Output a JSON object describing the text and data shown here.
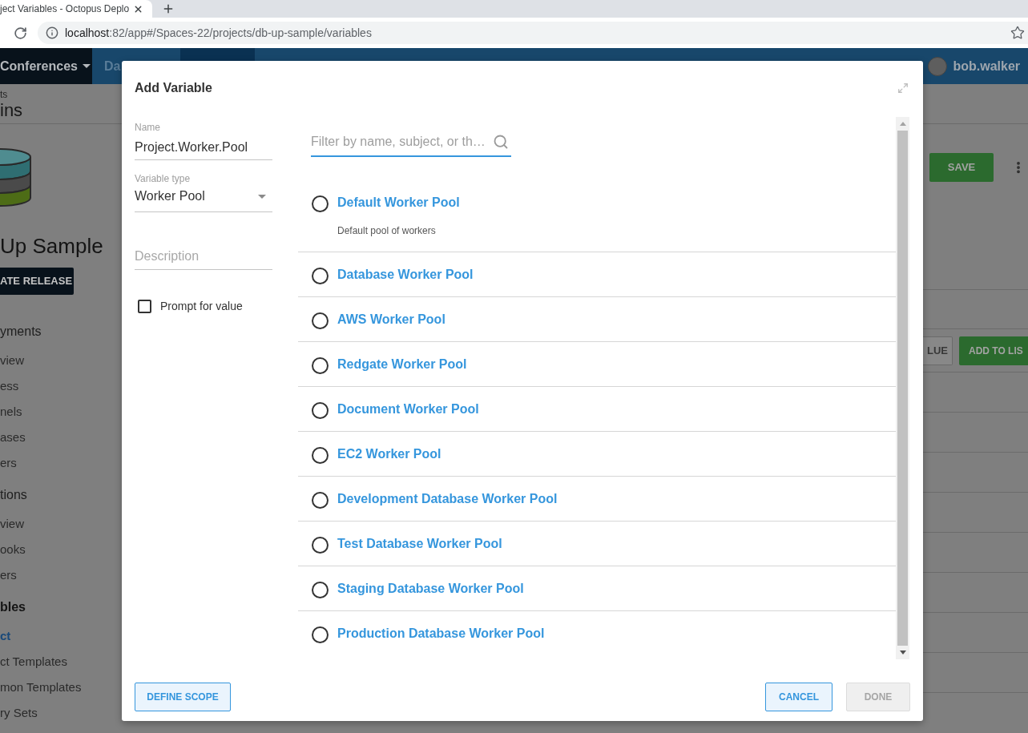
{
  "browser": {
    "tab_title": "ject Variables - Octopus Deplo",
    "address": {
      "host": "localhost",
      "path": ":82/app#/Spaces-22/projects/db-up-sample/variables"
    }
  },
  "header": {
    "space": "Conferences",
    "nav": [
      {
        "label": "Da",
        "selected": false
      },
      {
        "selected": true
      }
    ],
    "user": "bob.walker"
  },
  "page_header": {
    "breadcrumb": "ts",
    "title": "ins"
  },
  "sidebar": {
    "project_name": "Up Sample",
    "release_button": "ATE RELEASE",
    "sections": [
      {
        "title": "yments",
        "active": false,
        "items": [
          {
            "label": "view",
            "selected": false
          },
          {
            "label": "ess",
            "selected": false
          },
          {
            "label": "nels",
            "selected": false
          },
          {
            "label": "ases",
            "selected": false
          },
          {
            "label": "ers",
            "selected": false
          }
        ]
      },
      {
        "title": "tions",
        "active": false,
        "items": [
          {
            "label": "view",
            "selected": false
          },
          {
            "label": "ooks",
            "selected": false
          },
          {
            "label": "ers",
            "selected": false
          }
        ]
      },
      {
        "title": "bles",
        "active": true,
        "items": [
          {
            "label": "ct",
            "selected": true
          },
          {
            "label": "ct Templates",
            "selected": false
          },
          {
            "label": "mon Templates",
            "selected": false
          },
          {
            "label": "ry Sets",
            "selected": false
          }
        ]
      }
    ]
  },
  "content": {
    "save_button": "SAVE",
    "value_button": "LUE",
    "add_button": "ADD TO LIS"
  },
  "dialog": {
    "title": "Add Variable",
    "name": {
      "label": "Name",
      "value": "Project.Worker.Pool"
    },
    "variable_type": {
      "label": "Variable type",
      "value": "Worker Pool"
    },
    "description": {
      "placeholder": "Description"
    },
    "prompt": {
      "label": "Prompt for value",
      "checked": false
    },
    "filter": {
      "placeholder": "Filter by name, subject, or th…"
    },
    "pools": [
      {
        "name": "Default Worker Pool",
        "description": "Default pool of workers",
        "selected": false
      },
      {
        "name": "Database Worker Pool",
        "selected": false
      },
      {
        "name": "AWS Worker Pool",
        "selected": false
      },
      {
        "name": "Redgate Worker Pool",
        "selected": false
      },
      {
        "name": "Document Worker Pool",
        "selected": false
      },
      {
        "name": "EC2 Worker Pool",
        "selected": false
      },
      {
        "name": "Development Database Worker Pool",
        "selected": false
      },
      {
        "name": "Test Database Worker Pool",
        "selected": false
      },
      {
        "name": "Staging Database Worker Pool",
        "selected": false
      },
      {
        "name": "Production Database Worker Pool",
        "selected": false
      }
    ],
    "define_scope": "DEFINE SCOPE",
    "actions": [
      {
        "label": "CANCEL",
        "disabled": false
      },
      {
        "label": "DONE",
        "disabled": true
      }
    ]
  }
}
